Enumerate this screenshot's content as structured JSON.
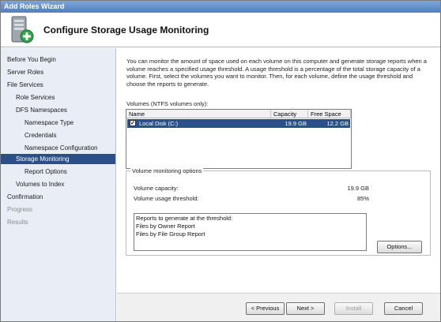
{
  "window": {
    "title": "Add Roles Wizard"
  },
  "header": {
    "title": "Configure Storage Usage Monitoring",
    "icon": "server-roles-icon"
  },
  "sidebar": {
    "items": [
      {
        "label": "Before You Begin",
        "state": "normal"
      },
      {
        "label": "Server Roles",
        "state": "normal"
      },
      {
        "label": "File Services",
        "state": "normal"
      },
      {
        "label": "Role Services",
        "state": "normal"
      },
      {
        "label": "DFS Namespaces",
        "state": "normal"
      },
      {
        "label": "Namespace Type",
        "state": "normal"
      },
      {
        "label": "Credentials",
        "state": "normal"
      },
      {
        "label": "Namespace Configuration",
        "state": "normal"
      },
      {
        "label": "Storage Monitoring",
        "state": "active"
      },
      {
        "label": "Report Options",
        "state": "normal"
      },
      {
        "label": "Volumes to Index",
        "state": "normal"
      },
      {
        "label": "Confirmation",
        "state": "normal"
      },
      {
        "label": "Progress",
        "state": "disabled"
      },
      {
        "label": "Results",
        "state": "disabled"
      }
    ]
  },
  "main": {
    "intro": "You can monitor the amount of space used on each volume on this computer and generate storage reports when a volume reaches a specified usage threshold.  A usage threshold is a percentage of the total storage capacity of a volume. First, select the volumes you want to monitor.  Then, for each volume, define the usage threshold and choose the reports to generate.",
    "volumes_label": "Volumes (NTFS volumes only):",
    "table": {
      "columns": [
        "Name",
        "Capacity",
        "Free Space"
      ],
      "rows": [
        {
          "name": "Local Disk (C:)",
          "capacity": "19.9 GB",
          "free": "12.2 GB",
          "checked": true,
          "selected": true
        }
      ]
    },
    "options": {
      "legend": "Volume monitoring options",
      "capacity_label": "Volume capacity:",
      "capacity_value": "19.9 GB",
      "threshold_label": "Volume usage threshold:",
      "threshold_value": "85%",
      "reports_label": "Reports to generate at the threshold:",
      "reports": [
        "Files by Owner Report",
        "Files by File Group Report"
      ],
      "options_button": "Options..."
    }
  },
  "footer": {
    "previous": "< Previous",
    "next": "Next >",
    "install": "Install",
    "cancel": "Cancel"
  },
  "colors": {
    "selection": "#2a4f8a",
    "sidebar_bg": "#e9eef6",
    "titlebar": "#5d8ac8"
  }
}
